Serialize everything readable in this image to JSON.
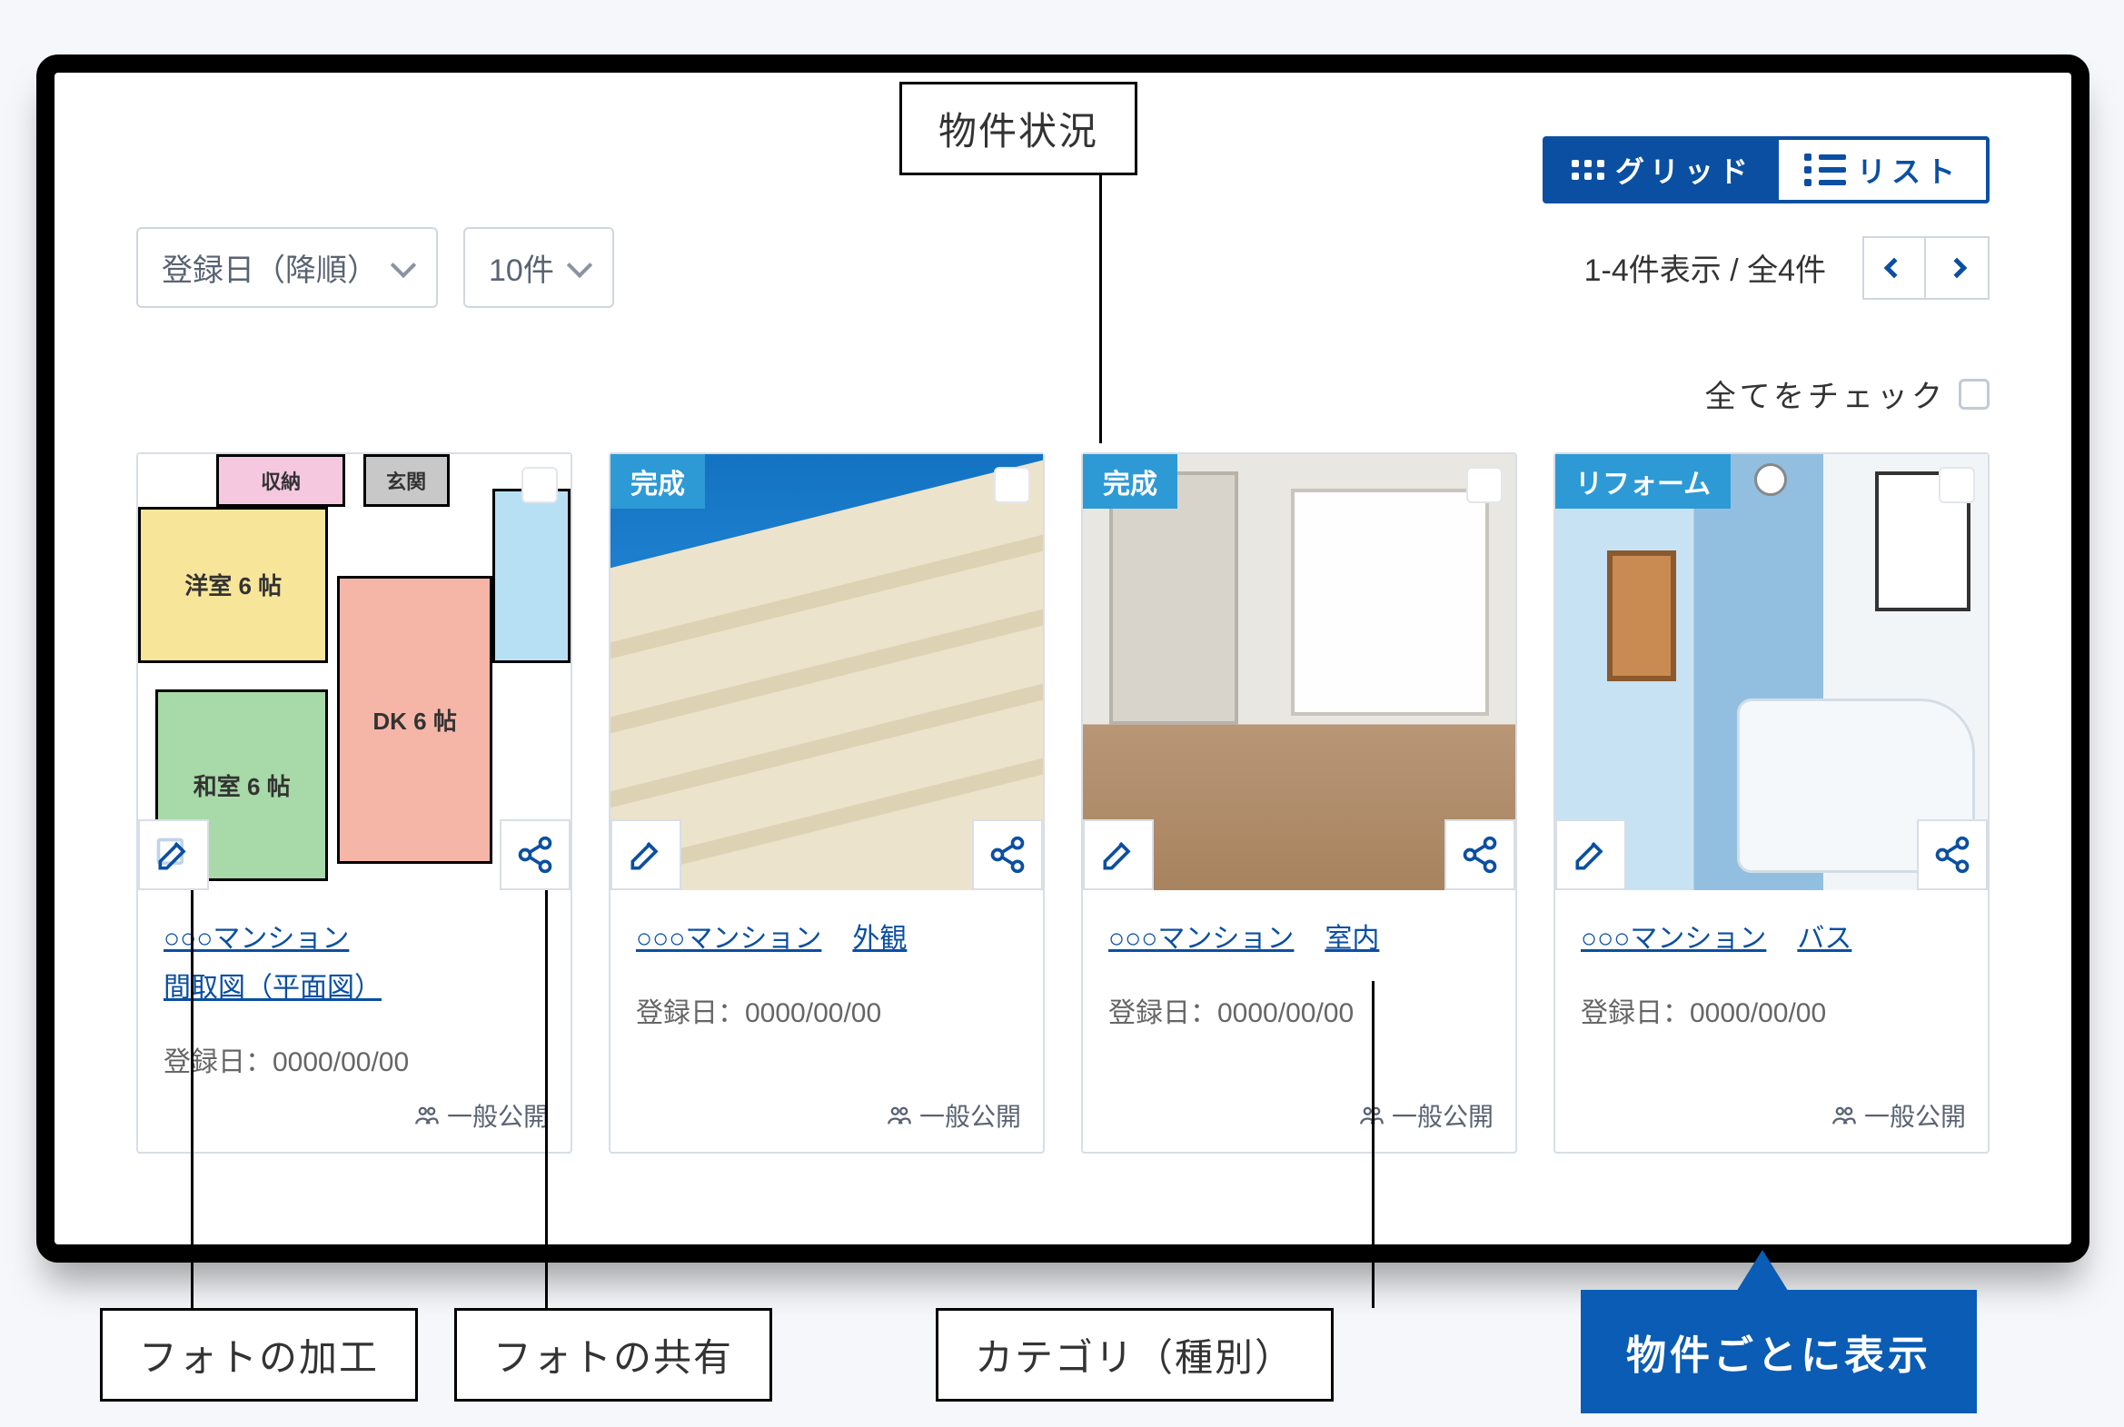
{
  "viewToggle": {
    "grid": "グリッド",
    "list": "リスト"
  },
  "sort": {
    "label": "登録日（降順）"
  },
  "pageSize": {
    "label": "10件"
  },
  "count": "1-4件表示 / 全4件",
  "checkAll": "全てをチェック",
  "dateLabelPrefix": "登録日：",
  "visibilityLabel": "一般公開",
  "cards": [
    {
      "status": "",
      "propertyName": "○○○マンション",
      "category": "間取図（平面図）",
      "date": "0000/00/00",
      "floorplan": {
        "yoshitsu": "洋室 6 帖",
        "washitsu": "和室 6 帖",
        "dk": "DK 6 帖",
        "shuno": "収納",
        "genkan": "玄関"
      }
    },
    {
      "status": "完成",
      "propertyName": "○○○マンション",
      "category": "外観",
      "date": "0000/00/00"
    },
    {
      "status": "完成",
      "propertyName": "○○○マンション",
      "category": "室内",
      "date": "0000/00/00"
    },
    {
      "status": "リフォーム",
      "propertyName": "○○○マンション",
      "category": "バス",
      "date": "0000/00/00"
    }
  ],
  "annotations": {
    "status": "物件状況",
    "editPhoto": "フォトの加工",
    "sharePhoto": "フォトの共有",
    "category": "カテゴリ（種別）",
    "perProperty": "物件ごとに表示"
  }
}
